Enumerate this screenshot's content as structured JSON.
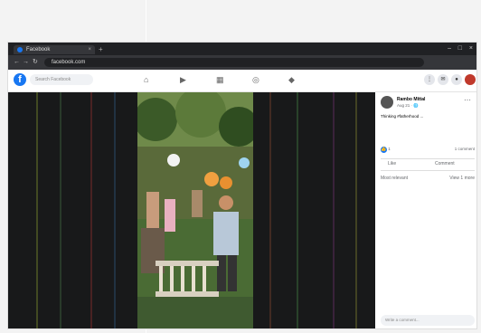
{
  "browser": {
    "tab_title": "Facebook",
    "tab_close": "×",
    "new_tab": "+",
    "window_controls": [
      "–",
      "□",
      "×"
    ],
    "back": "←",
    "forward": "→",
    "reload": "↻",
    "url": "facebook.com"
  },
  "facebook": {
    "logo": "f",
    "search_placeholder": "Search Facebook"
  },
  "post": {
    "author": "Rambo Mittal",
    "date": "Aug 21 · 🌐",
    "text": "Thinking #fatherhood ...",
    "reaction_count": "1",
    "comments": "1 comment",
    "like_label": "Like",
    "comment_label": "Comment",
    "relevant_label": "Most relevant",
    "view_label": "View 1 more",
    "compose_placeholder": "Write a comment..."
  },
  "colors": {
    "brand": "#1877f2",
    "topbar": "#202124",
    "video_bg": "#18191a"
  }
}
